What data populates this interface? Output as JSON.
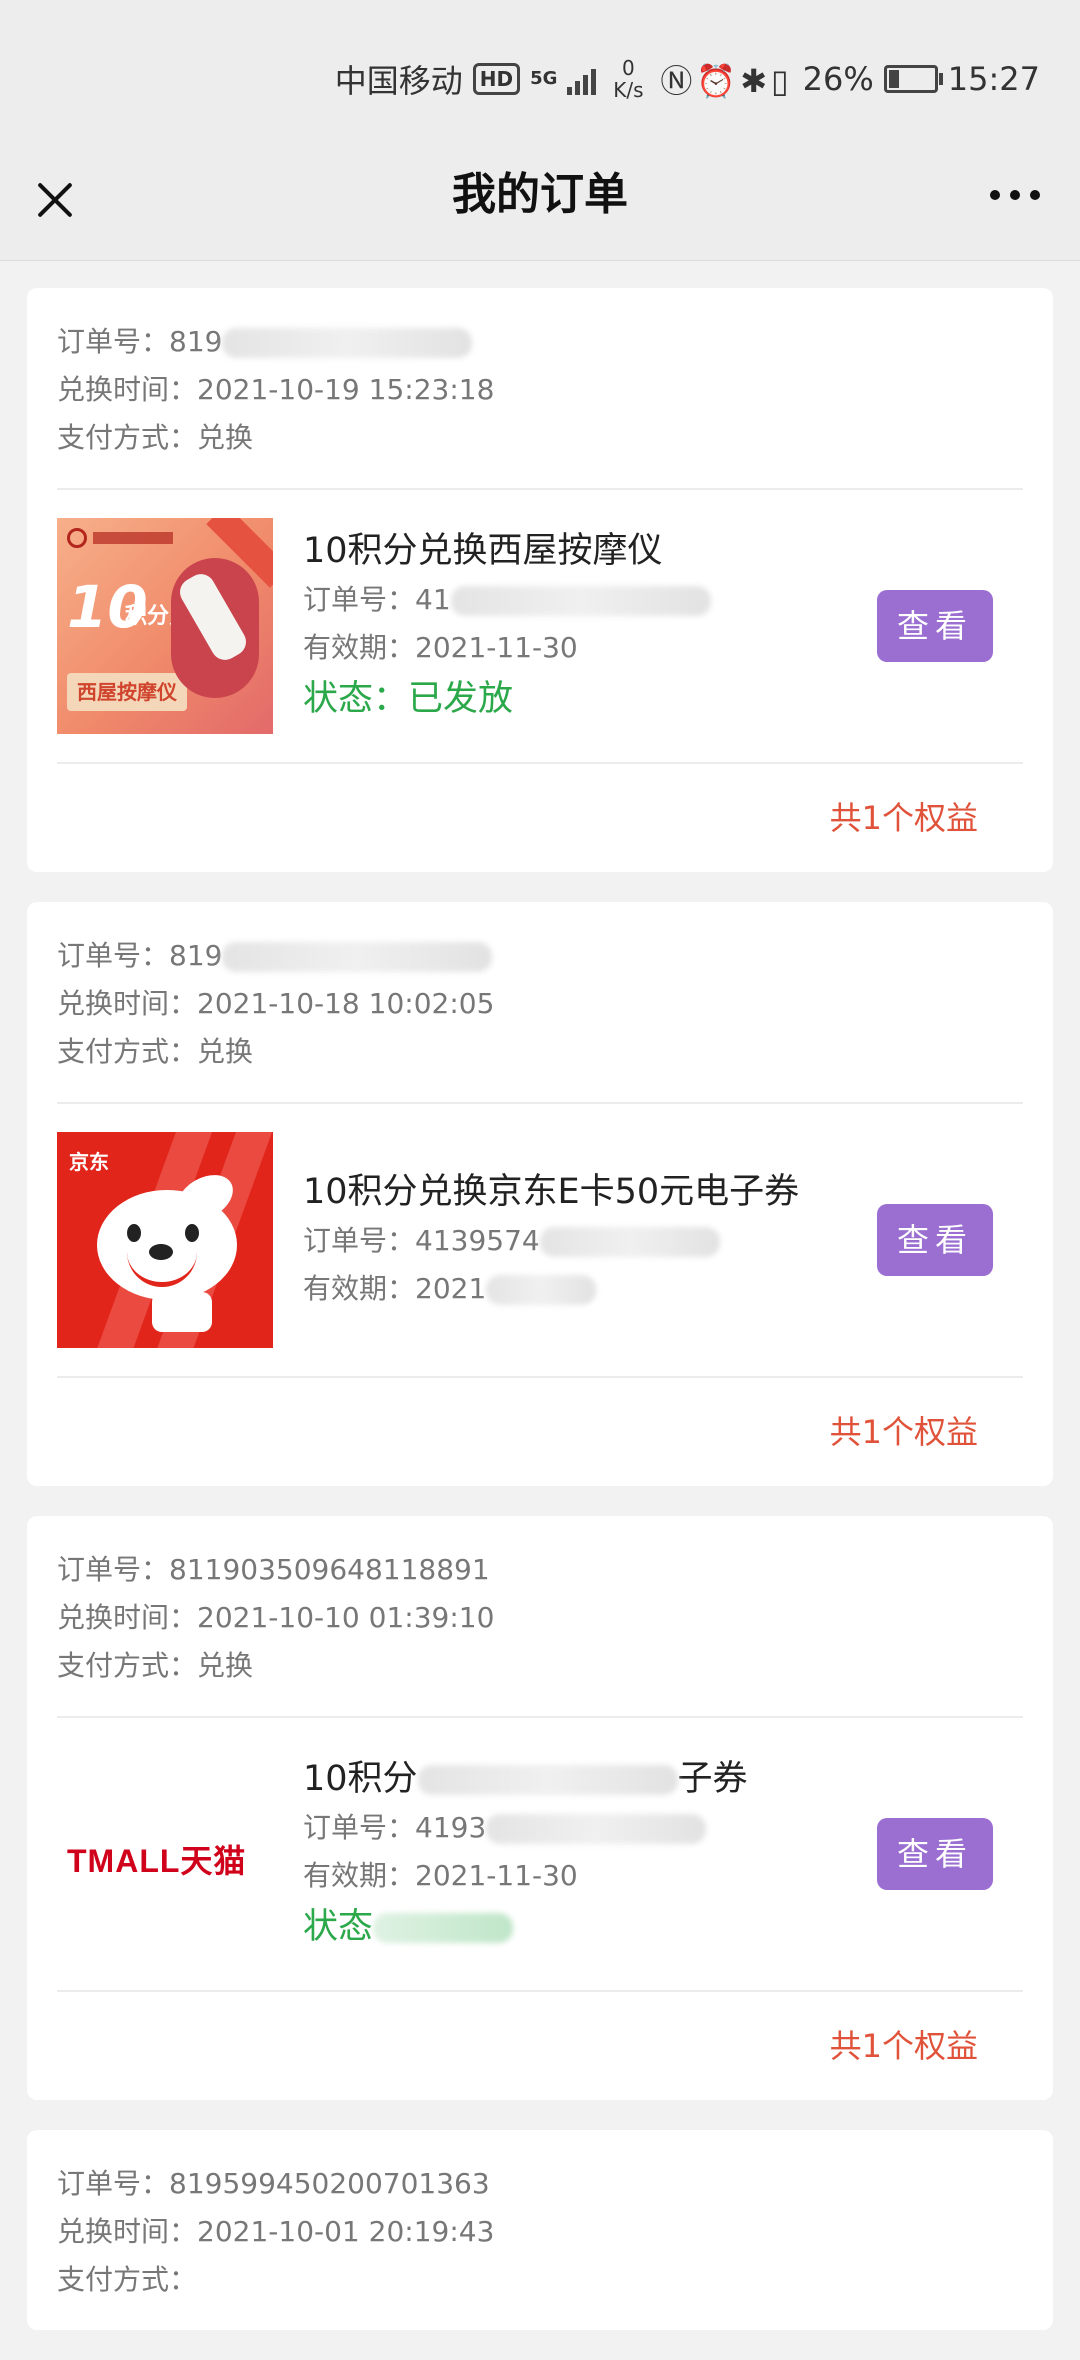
{
  "status_bar": {
    "carrier": "中国移动",
    "hd": "HD",
    "network": "5G",
    "speed_value": "0",
    "speed_unit": "K/s",
    "battery": "26%",
    "time": "15:27"
  },
  "nav": {
    "title": "我的订单"
  },
  "labels": {
    "order_no": "订单号：",
    "exchange_time": "兑换时间：",
    "payment": "支付方式：",
    "validity": "有效期：",
    "status": "状态："
  },
  "orders": [
    {
      "order_no": "819",
      "exchange_time": "2021-10-19 15:23:18",
      "payment": "兑换",
      "product": {
        "title": "10积分兑换西屋按摩仪",
        "order_no": "41",
        "validity": "2021-11-30",
        "status": "已发放",
        "thumb_num": "10",
        "thumb_sub": "积分兑",
        "thumb_tag": "西屋按摩仪"
      },
      "button": "查看",
      "benefit_count": "共1个权益"
    },
    {
      "order_no": "819",
      "exchange_time": "2021-10-18 10:02:05",
      "payment": "兑换",
      "product": {
        "title": "10积分兑换京东E卡50元电子券",
        "order_no": "4139574",
        "validity": "2021",
        "thumb_logo": "京东"
      },
      "button": "查看",
      "benefit_count": "共1个权益"
    },
    {
      "order_no": "811903509648118891",
      "exchange_time": "2021-10-10 01:39:10",
      "payment": "兑换",
      "product": {
        "title_start": "10积分",
        "title_end": "子券",
        "order_no": "4193",
        "validity": "2021-11-30",
        "status_label": "状态",
        "thumb_logo": "TMALL天猫"
      },
      "button": "查看",
      "benefit_count": "共1个权益"
    },
    {
      "order_no": "819599450200701363",
      "exchange_time": "2021-10-01 20:19:43",
      "payment": ""
    }
  ]
}
